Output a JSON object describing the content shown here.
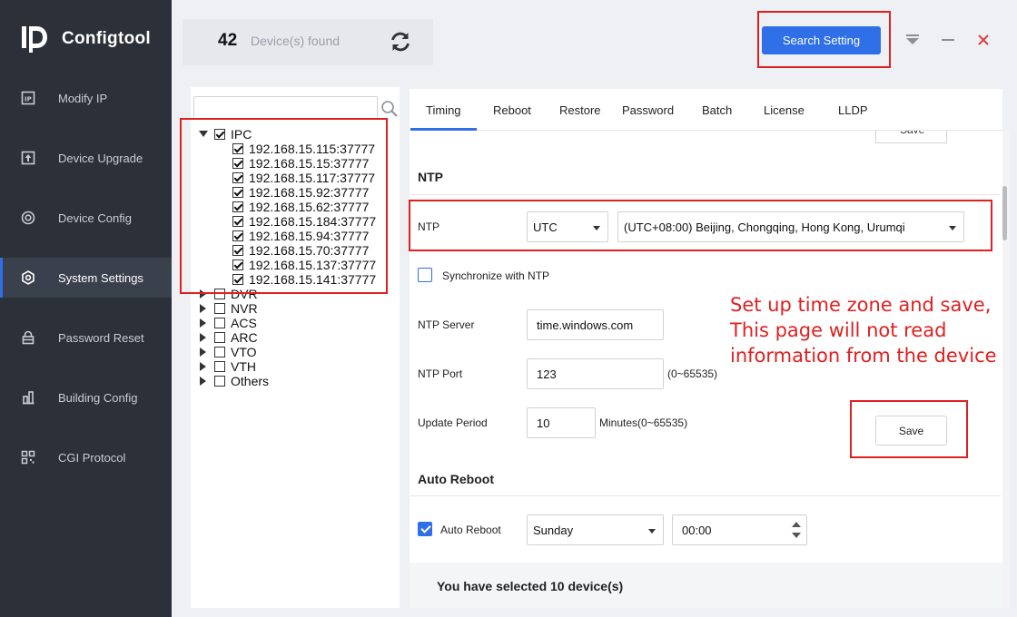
{
  "app": {
    "name": "Configtool"
  },
  "sidebar": {
    "items": [
      {
        "label": "Modify IP",
        "icon": "modify-ip-icon"
      },
      {
        "label": "Device Upgrade",
        "icon": "upgrade-icon"
      },
      {
        "label": "Device Config",
        "icon": "device-config-icon"
      },
      {
        "label": "System Settings",
        "icon": "system-settings-icon",
        "active": true
      },
      {
        "label": "Password Reset",
        "icon": "password-reset-icon"
      },
      {
        "label": "Building Config",
        "icon": "building-config-icon"
      },
      {
        "label": "CGI Protocol",
        "icon": "cgi-protocol-icon"
      }
    ]
  },
  "header": {
    "device_count": "42",
    "device_count_label": "Device(s) found",
    "search_setting_label": "Search Setting"
  },
  "tree": {
    "groups": [
      {
        "label": "IPC",
        "expanded": true,
        "checked": true,
        "children": [
          "192.168.15.115:37777",
          "192.168.15.15:37777",
          "192.168.15.117:37777",
          "192.168.15.92:37777",
          "192.168.15.62:37777",
          "192.168.15.184:37777",
          "192.168.15.94:37777",
          "192.168.15.70:37777",
          "192.168.15.137:37777",
          "192.168.15.141:37777"
        ]
      },
      {
        "label": "DVR",
        "expanded": false,
        "checked": false
      },
      {
        "label": "NVR",
        "expanded": false,
        "checked": false
      },
      {
        "label": "ACS",
        "expanded": false,
        "checked": false
      },
      {
        "label": "ARC",
        "expanded": false,
        "checked": false
      },
      {
        "label": "VTO",
        "expanded": false,
        "checked": false
      },
      {
        "label": "VTH",
        "expanded": false,
        "checked": false
      },
      {
        "label": "Others",
        "expanded": false,
        "checked": false
      }
    ]
  },
  "tabs": [
    {
      "label": "Timing",
      "active": true
    },
    {
      "label": "Reboot"
    },
    {
      "label": "Restore"
    },
    {
      "label": "Password"
    },
    {
      "label": "Batch"
    },
    {
      "label": "License"
    },
    {
      "label": "LLDP"
    }
  ],
  "ntp": {
    "section_title": "NTP",
    "ntp_label": "NTP",
    "ntp_type": "UTC",
    "timezone": "(UTC+08:00) Beijing, Chongqing, Hong Kong, Urumqi",
    "sync_label": "Synchronize with NTP",
    "sync_checked": false,
    "server_label": "NTP Server",
    "server_value": "time.windows.com",
    "port_label": "NTP Port",
    "port_value": "123",
    "port_range": "(0~65535)",
    "period_label": "Update Period",
    "period_value": "10",
    "period_unit": "Minutes(0~65535)",
    "save_label": "Save"
  },
  "auto_reboot": {
    "section_title": "Auto Reboot",
    "label": "Auto Reboot",
    "checked": true,
    "day": "Sunday",
    "time": "00:00"
  },
  "footer": {
    "selected_text": "You have selected 10 device(s)"
  },
  "annotation": {
    "lines": [
      "Set up time zone and save,",
      "This page will not read",
      "information from the device"
    ]
  },
  "colors": {
    "accent": "#2f6fe8",
    "annotation": "#e02020",
    "sidebar": "#2c3038"
  }
}
